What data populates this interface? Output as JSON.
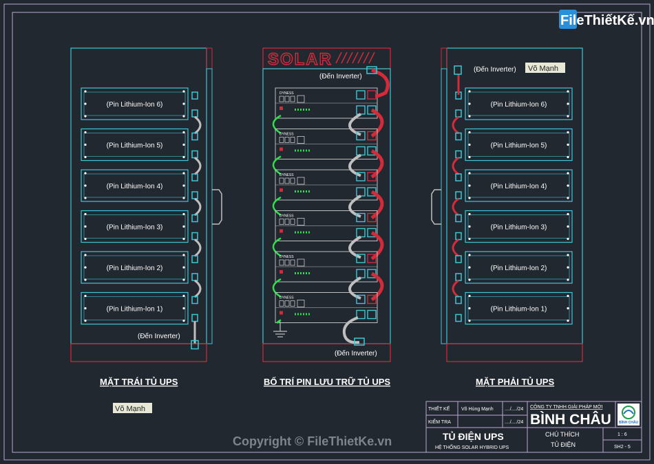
{
  "watermark": {
    "logo_text": "FileThiếtKế.vn",
    "copyright": "Copyright © FileThietKe.vn"
  },
  "left_panel": {
    "title": "MẶT TRÁI TỦ UPS",
    "batteries": [
      "(Pin Lithium-Ion 6)",
      "(Pin Lithium-Ion 5)",
      "(Pin Lithium-Ion 4)",
      "(Pin Lithium-Ion 3)",
      "(Pin Lithium-Ion 2)",
      "(Pin Lithium-Ion 1)"
    ],
    "inverter_note": "(Đến Inverter)"
  },
  "center_panel": {
    "title": "BỐ TRÍ PIN LƯU TRỮ TỦ UPS",
    "banner": "SOLAR",
    "inverter_top": "(Đến Inverter)",
    "inverter_bottom": "(Đến Inverter)",
    "module_brand": "DYNESS",
    "module_count": 6
  },
  "right_panel": {
    "title": "MẶT PHẢI TỦ UPS",
    "batteries": [
      "(Pin Lithium-Ion 6)",
      "(Pin Lithium-Ion 5)",
      "(Pin Lithium-Ion 4)",
      "(Pin Lithium-Ion 3)",
      "(Pin Lithium-Ion 2)",
      "(Pin Lithium-Ion 1)"
    ],
    "inverter_note": "(Đến Inverter)",
    "author_tag": "Võ Mạnh"
  },
  "author_tag_bottom": "Võ Mạnh",
  "title_block": {
    "designer_label": "THIẾT KẾ",
    "designer_name": "Võ Hùng Mạnh",
    "designer_date": "..../..../24",
    "checker_label": "KIỂM TRA",
    "checker_date": "..../..../24",
    "company_line": "CÔNG TY TNHH GIẢI PHÁP MỚI",
    "company_name": "BÌNH CHÂU",
    "logo_text": "BÌNH CHÂU",
    "drawing_title": "TỦ ĐIỆN UPS",
    "drawing_subtitle": "HỆ THỐNG SOLAR HYBRID UPS",
    "note_label": "CHÚ THÍCH",
    "note_value": "TỦ ĐIỆN",
    "scale": "1 : 6",
    "sheet": "SH2 - 5"
  },
  "colors": {
    "background": "#222830",
    "frame": "#b9a7d6",
    "cyan": "#3cc7d6",
    "red": "#d42a3a",
    "green": "#2ee04a",
    "grey": "#bfbfbf"
  }
}
